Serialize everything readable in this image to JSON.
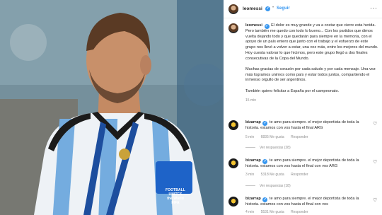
{
  "photo": {
    "caption_lines": [
      "FOOTBALL",
      "UNITES",
      "the World",
      "FIFA"
    ]
  },
  "post": {
    "username": "leomessi",
    "follow_label": "Seguir",
    "more_icon": "more-horizontal-icon",
    "caption": [
      "El dolor es muy grande y va a costar que cierre esta herida. Pero también me quedo con todo lo bueno... Con los partidos que dimos vuelta dejando todo y que quedarán para siempre en la memoria, con el apoyo de un país entero que junto con el trabajo y el esfuerzo de este grupo nos llevó a volver a estar, una vez más, entre los mejores del mundo. Hoy cuesta valorar lo que hicimos, pero este grupo llegó a dos finales consecutivas de la Copa del Mundo.",
      "Muchas gracias de corazón por cada saludo y por cada mensaje. Una vez más logramos unirnos como país y estar todos juntos, compartiendo el inmenso orgullo de ser argentinos.",
      "También quiero felicitar a España por el campeonato."
    ],
    "time": "15 min"
  },
  "comments": [
    {
      "username": "bizarrap",
      "text": "te amo para siempre. el mejor deportista de toda la historia. estamos con vos hasta el final ARG",
      "time": "5 min",
      "likes": "6835 Me gusta",
      "reply": "Responder",
      "replies": "Ver respuestas (28)"
    },
    {
      "username": "bizarrap",
      "text": "te amo para siempre. el mejor deportista de toda la historia. estamos con vos hasta el final con vos ARG",
      "time": "3 min",
      "likes": "5318 Me gusta",
      "reply": "Responder",
      "replies": "Ver respuestas (18)"
    },
    {
      "username": "bizarrap",
      "text": "te amo para siempre. el mejor deportista de toda la historia. estamos con vos hasta el final con vos",
      "time": "4 min",
      "likes": "5531 Me gusta",
      "reply": "Responder"
    }
  ],
  "colors": {
    "link": "#3897f0",
    "muted": "#8e8e8e",
    "jersey_blue": "#74acdf",
    "armband": "#1e63c8"
  }
}
